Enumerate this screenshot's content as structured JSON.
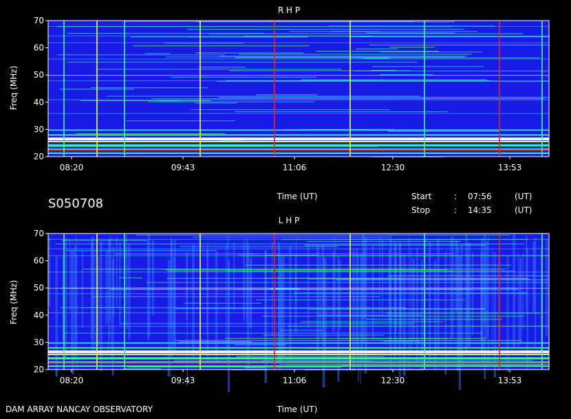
{
  "chart_data": [
    {
      "type": "heatmap",
      "title": "R H P",
      "ylabel": "Freq (MHz)",
      "xlabel": "Time (UT)",
      "ylim": [
        20,
        70
      ],
      "yticks": [
        "20",
        "30",
        "40",
        "50",
        "60",
        "70"
      ],
      "xticks": [
        "08:20",
        "09:43",
        "11:06",
        "12:30",
        "13:53"
      ],
      "colorscale": [
        "#1a1ae6",
        "#2f6cf5",
        "#35c9f0",
        "#3df58a",
        "#e8f53a",
        "#e02a1a",
        "#ffffff"
      ]
    },
    {
      "type": "heatmap",
      "title": "L H P",
      "ylabel": "Freq (MHz)",
      "xlabel": "Time (UT)",
      "ylim": [
        20,
        70
      ],
      "yticks": [
        "20",
        "30",
        "40",
        "50",
        "60",
        "70"
      ],
      "xticks": [
        "08:20",
        "09:43",
        "11:06",
        "12:30",
        "13:53"
      ],
      "colorscale": [
        "#1a1ae6",
        "#2f6cf5",
        "#35c9f0",
        "#3df58a",
        "#e8f53a",
        "#e02a1a",
        "#ffffff"
      ]
    }
  ],
  "session_id": "S050708",
  "start_label": "Start",
  "start_sep": ":",
  "start_time": "07:56",
  "start_unit": "(UT)",
  "stop_label": "Stop",
  "stop_sep": ":",
  "stop_time": "14:35",
  "stop_unit": "(UT)",
  "footer_left": "DAM ARRAY   NANCAY OBSERVATORY"
}
